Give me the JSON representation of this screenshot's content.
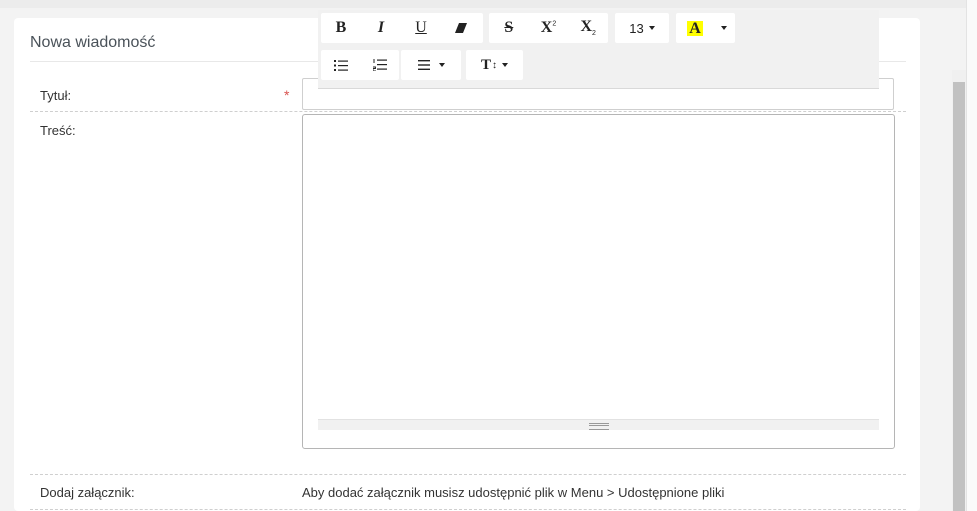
{
  "form": {
    "title": "Nowa wiadomość",
    "title_field_label": "Tytuł:",
    "required_mark": "*",
    "content_field_label": "Treść:",
    "attachment_label": "Dodaj załącznik:",
    "attachment_info": "Aby dodać załącznik musisz udostępnić plik w Menu > Udostępnione pliki",
    "title_value": "",
    "content_value": ""
  },
  "toolbar": {
    "bold": "B",
    "italic": "I",
    "underline": "U",
    "strikethrough": "S",
    "superscript": "X",
    "superscript_mark": "2",
    "subscript": "X",
    "subscript_mark": "2",
    "font_size": "13",
    "highlight_letter": "A",
    "text_height_letter": "T",
    "highlight_color": "#ffff00",
    "icons": [
      "bold-icon",
      "italic-icon",
      "underline-icon",
      "eraser-icon",
      "strikethrough-icon",
      "superscript-icon",
      "subscript-icon",
      "font-size-dropdown",
      "highlight-color-icon",
      "bullet-list-icon",
      "numbered-list-icon",
      "align-icon",
      "line-height-icon"
    ]
  }
}
